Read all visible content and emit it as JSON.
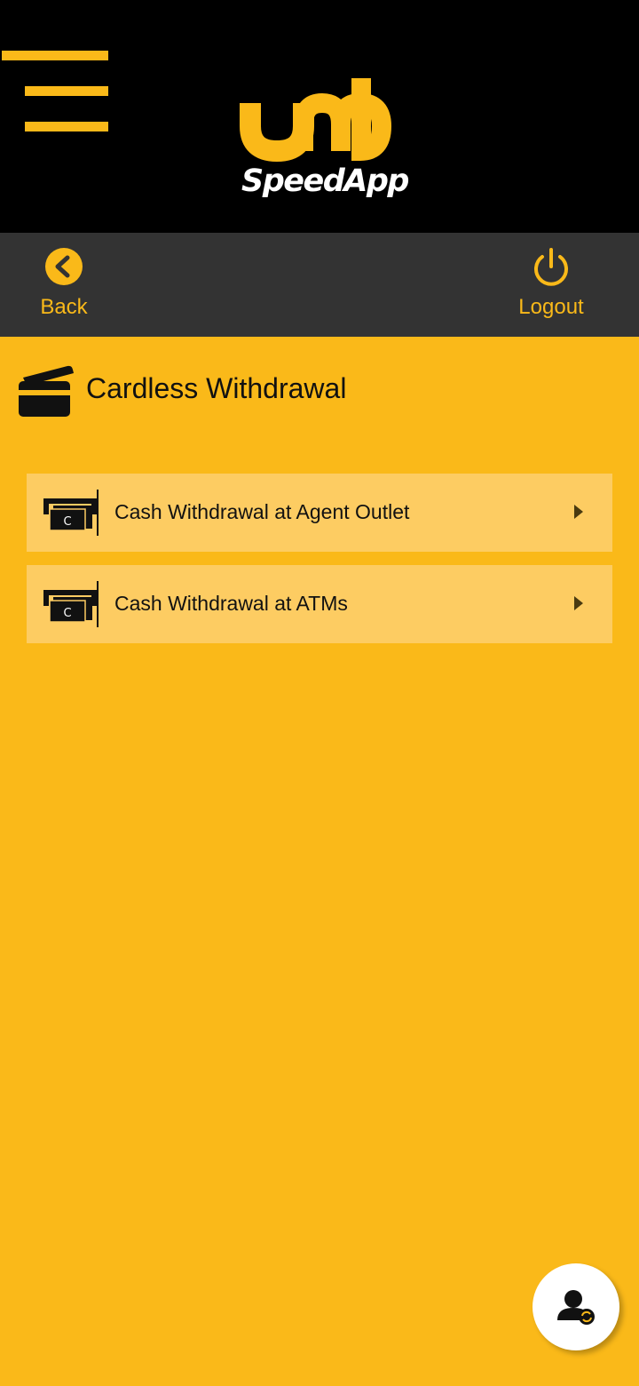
{
  "brand": {
    "logo_mark": "umb",
    "logo_text": "SpeedApp",
    "accent_color": "#FAB919",
    "header_color": "#000000",
    "navbar_color": "#333333"
  },
  "header": {
    "menu_icon": "hamburger-menu-icon"
  },
  "nav": {
    "back_label": "Back",
    "back_icon": "chevron-left-circle-icon",
    "logout_label": "Logout",
    "logout_icon": "power-icon"
  },
  "page": {
    "title": "Cardless Withdrawal",
    "title_icon": "cards-icon"
  },
  "options": [
    {
      "label": "Cash Withdrawal at Agent Outlet",
      "icon": "cash-dispense-icon",
      "arrow_icon": "caret-right-icon"
    },
    {
      "label": "Cash Withdrawal at ATMs",
      "icon": "cash-dispense-icon",
      "arrow_icon": "caret-right-icon"
    }
  ],
  "fab": {
    "icon": "user-sync-icon"
  }
}
